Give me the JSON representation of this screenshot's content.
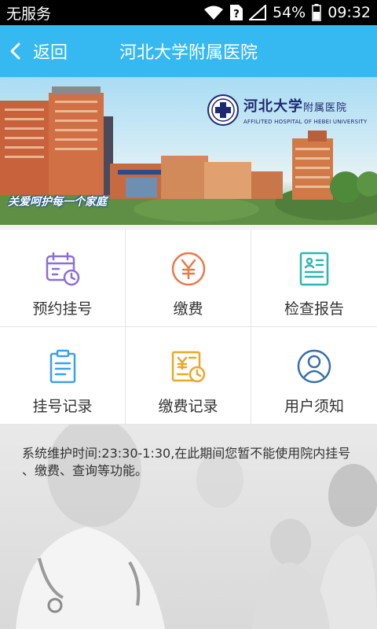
{
  "status_bar": {
    "carrier": "无服务",
    "battery_percent": "54%",
    "time": "09:32",
    "icons": [
      "wifi-icon",
      "sim-alert-icon",
      "signal-icon",
      "battery-icon"
    ]
  },
  "title_bar": {
    "back_label": "返回",
    "title": "河北大学附属医院",
    "background_color": "#36b8f0"
  },
  "banner": {
    "logo_cn": "河北大学",
    "logo_cn_small": "附属医院",
    "logo_en": "AFFILITED HOSPITAL OF HEBEI UNIVERSITY",
    "slogan": "关爱呵护每一个家庭"
  },
  "menu": {
    "items": [
      {
        "label": "预约挂号",
        "icon": "calendar-clock-icon",
        "color": "#8a6fd6"
      },
      {
        "label": "缴费",
        "icon": "yen-icon",
        "color": "#e8784a"
      },
      {
        "label": "检查报告",
        "icon": "report-icon",
        "color": "#2bb7b0"
      },
      {
        "label": "挂号记录",
        "icon": "clipboard-icon",
        "color": "#3aa0e8"
      },
      {
        "label": "缴费记录",
        "icon": "payment-record-icon",
        "color": "#e8a82a"
      },
      {
        "label": "用户须知",
        "icon": "user-icon",
        "color": "#3a6fa8"
      }
    ]
  },
  "notice": {
    "text": "系统维护时间:23:30-1:30,在此期间您暂不能使用院内挂号 、缴费、查询等功能。"
  }
}
